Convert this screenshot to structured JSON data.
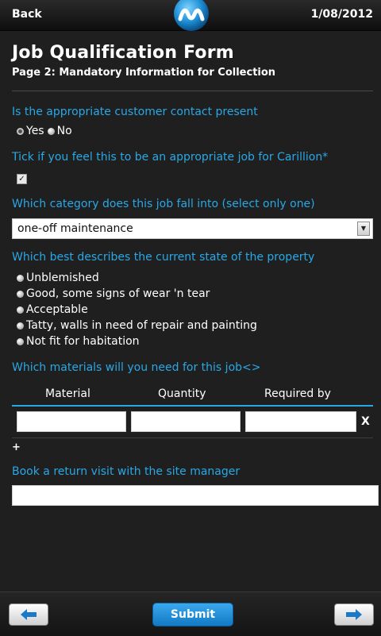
{
  "header": {
    "back_label": "Back",
    "date": "1/08/2012",
    "logo_icon": "m-logo-icon"
  },
  "form": {
    "title": "Job Qualification Form",
    "subtitle": "Page 2: Mandatory Information for Collection",
    "q1": {
      "label": "Is the appropriate customer contact present",
      "options": [
        "Yes",
        "No"
      ],
      "selected": "Yes"
    },
    "q2": {
      "label": "Tick if you feel this to be an appropriate job for Carillion*",
      "checked": true
    },
    "q3": {
      "label": "Which category does this job fall into (select only one)",
      "selected_value": "one-off maintenance"
    },
    "q4": {
      "label": "Which best describes the current state of the property",
      "options": [
        "Unblemished",
        "Good, some signs of wear 'n tear",
        "Acceptable",
        "Tatty, walls in need of repair and painting",
        "Not fit for habitation"
      ]
    },
    "q5": {
      "label": "Which materials will you need for this job<>",
      "columns": [
        "Material",
        "Quantity",
        "Required by"
      ],
      "rows": [
        [
          "",
          "",
          ""
        ]
      ],
      "remove_label": "X",
      "add_label": "+"
    },
    "q6": {
      "label": "Book a return visit with the site manager",
      "value": ""
    }
  },
  "footer": {
    "submit_label": "Submit",
    "prev_icon": "arrow-left-icon",
    "next_icon": "arrow-right-icon"
  },
  "colors": {
    "accent": "#29a8e6",
    "background": "#1f1f1f",
    "submit": "#1f8ad6"
  }
}
